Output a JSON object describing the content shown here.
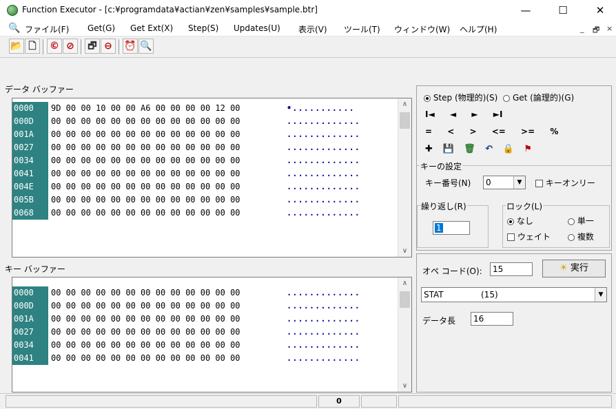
{
  "window": {
    "title": "Function Executor - [c:¥programdata¥actian¥zen¥samples¥sample.btr]",
    "minimize": "—",
    "maximize": "☐",
    "close": "✕"
  },
  "menu": {
    "items": [
      "ファイル(F)",
      "Get(G)",
      "Get Ext(X)",
      "Step(S)",
      "Updates(U)",
      "表示(V)",
      "ツール(T)",
      "ウィンドウ(W)",
      "ヘルプ(H)"
    ],
    "mdi_min": "_",
    "mdi_restore": "🗗",
    "mdi_close": "×"
  },
  "toolbar": {
    "icons": [
      "open-folder-icon",
      "new-file-icon",
      "open-file-icon",
      "close-file-icon",
      "properties-icon",
      "stop-icon",
      "reset-icon",
      "search-icon"
    ],
    "glyphs": [
      "📂",
      "🗋",
      "©",
      "⊘",
      "🗗",
      "⊖",
      "⏰",
      "🔍"
    ]
  },
  "data_buffer": {
    "label": "データ バッファー",
    "rows": [
      {
        "addr": "0000",
        "bytes": "9D 00 00 10 00 00 A6 00 00 00 00 12 00",
        "ascii": "•..........."
      },
      {
        "addr": "000D",
        "bytes": "00 00 00 00 00 00 00 00 00 00 00 00 00",
        "ascii": "............."
      },
      {
        "addr": "001A",
        "bytes": "00 00 00 00 00 00 00 00 00 00 00 00 00",
        "ascii": "............."
      },
      {
        "addr": "0027",
        "bytes": "00 00 00 00 00 00 00 00 00 00 00 00 00",
        "ascii": "............."
      },
      {
        "addr": "0034",
        "bytes": "00 00 00 00 00 00 00 00 00 00 00 00 00",
        "ascii": "............."
      },
      {
        "addr": "0041",
        "bytes": "00 00 00 00 00 00 00 00 00 00 00 00 00",
        "ascii": "............."
      },
      {
        "addr": "004E",
        "bytes": "00 00 00 00 00 00 00 00 00 00 00 00 00",
        "ascii": "............."
      },
      {
        "addr": "005B",
        "bytes": "00 00 00 00 00 00 00 00 00 00 00 00 00",
        "ascii": "............."
      },
      {
        "addr": "0068",
        "bytes": "00 00 00 00 00 00 00 00 00 00 00 00 00",
        "ascii": "............."
      }
    ]
  },
  "key_buffer": {
    "label": "キー バッファー",
    "rows": [
      {
        "addr": "0000",
        "bytes": "00 00 00 00 00 00 00 00 00 00 00 00 00",
        "ascii": "............."
      },
      {
        "addr": "000D",
        "bytes": "00 00 00 00 00 00 00 00 00 00 00 00 00",
        "ascii": "............."
      },
      {
        "addr": "001A",
        "bytes": "00 00 00 00 00 00 00 00 00 00 00 00 00",
        "ascii": "............."
      },
      {
        "addr": "0027",
        "bytes": "00 00 00 00 00 00 00 00 00 00 00 00 00",
        "ascii": "............."
      },
      {
        "addr": "0034",
        "bytes": "00 00 00 00 00 00 00 00 00 00 00 00 00",
        "ascii": "............."
      },
      {
        "addr": "0041",
        "bytes": "00 00 00 00 00 00 00 00 00 00 00 00 00",
        "ascii": "............."
      }
    ]
  },
  "mode": {
    "step_label": "Step (物理的)(S)",
    "get_label": "Get (論理的)(G)",
    "selected": "step"
  },
  "nav": {
    "row1": [
      "I◄",
      "◄",
      "►",
      "►I"
    ],
    "row2": [
      "=",
      "<",
      ">",
      "<=",
      ">=",
      "%"
    ],
    "row3_icons": [
      "insert-icon",
      "save-icon",
      "delete-icon",
      "undo-icon",
      "lock-icon",
      "flag-icon"
    ],
    "row3_glyphs": [
      "✚",
      "💾",
      "🗑",
      "↶",
      "🔒",
      "⚑"
    ]
  },
  "key_settings": {
    "group_label": "キーの設定",
    "key_number_label": "キー番号(N)",
    "key_number_value": "0",
    "key_only_label": "キーオンリー"
  },
  "repeat": {
    "group_label": "繰り返し(R)",
    "value": "1"
  },
  "lock": {
    "group_label": "ロック(L)",
    "none_label": "なし",
    "single_label": "単一",
    "wait_label": "ウェイト",
    "multi_label": "複数",
    "selected": "none"
  },
  "operation": {
    "opcode_label": "オペ コード(O):",
    "opcode_value": "15",
    "execute_label": "実行",
    "op_name": "STAT",
    "op_code_display": "(15)",
    "data_length_label": "データ長",
    "data_length_value": "16"
  },
  "status": {
    "cells": [
      "",
      "0",
      "",
      ""
    ]
  }
}
